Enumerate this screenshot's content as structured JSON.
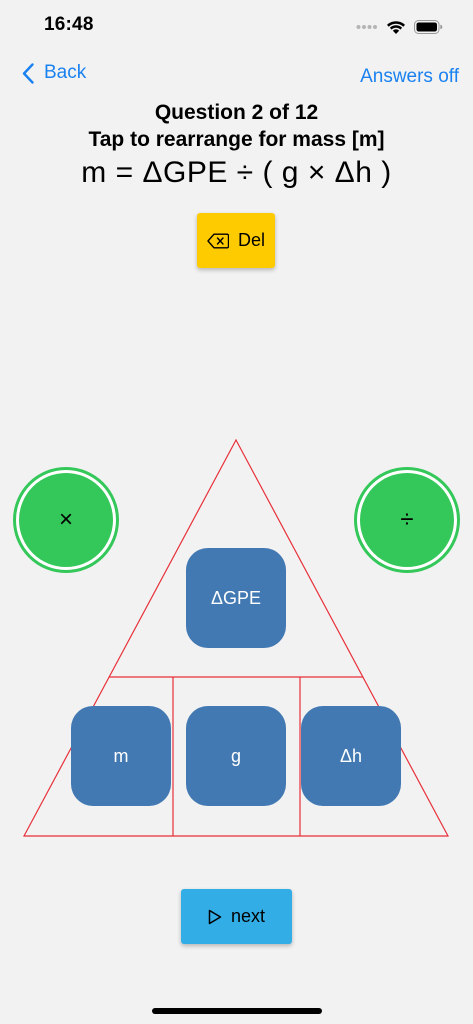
{
  "status_bar": {
    "time": "16:48",
    "icons": [
      "signal-dots-icon",
      "wifi-icon",
      "battery-icon"
    ]
  },
  "nav": {
    "back_label": "Back",
    "answers_label": "Answers off"
  },
  "question": {
    "title": "Question 2 of 12",
    "instruction": "Tap to rearrange for mass [m]",
    "equation": "m = ΔGPE ÷ ( g × Δh )"
  },
  "toolbar": {
    "del_label": "Del"
  },
  "operators": {
    "times": "×",
    "divide": "÷"
  },
  "tiles": {
    "top": "ΔGPE",
    "left": "m",
    "middle": "g",
    "right": "Δh"
  },
  "footer": {
    "next_label": "next"
  },
  "colors": {
    "accent_blue": "#1a82f0",
    "del_yellow": "#fecb00",
    "operator_green": "#34c759",
    "tile_blue": "#4279b2",
    "next_blue": "#32ade6",
    "triangle_red": "#e8303a"
  }
}
